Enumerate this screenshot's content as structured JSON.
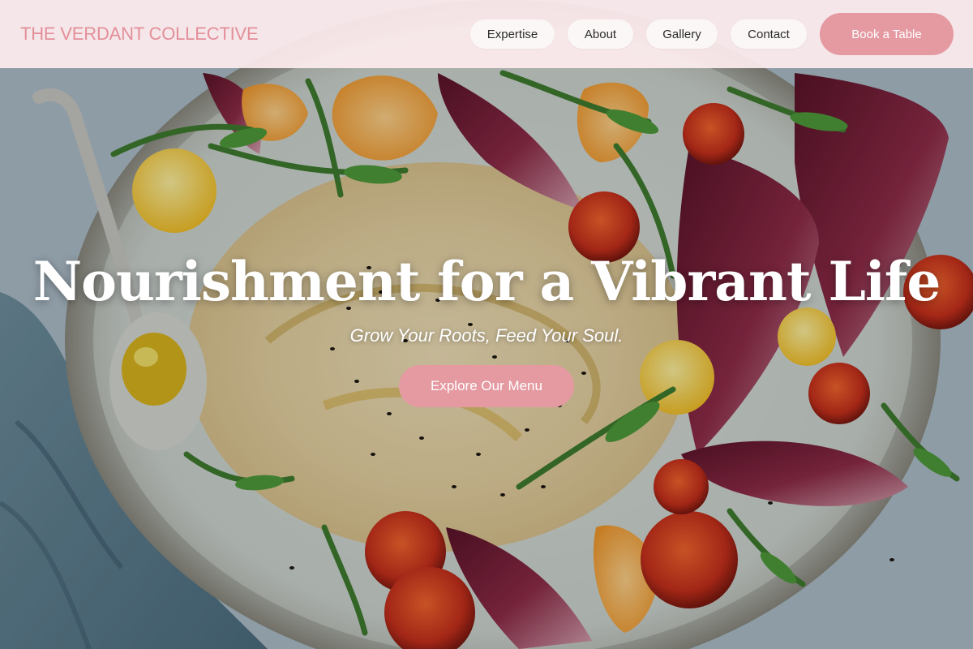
{
  "header": {
    "brand": "THE VERDANT COLLECTIVE",
    "nav": [
      {
        "label": "Expertise"
      },
      {
        "label": "About"
      },
      {
        "label": "Gallery"
      },
      {
        "label": "Contact"
      }
    ],
    "cta_label": "Book a Table"
  },
  "hero": {
    "title": "Nourishment for a Vibrant Life",
    "subtitle": "Grow Your Roots, Feed Your Soul.",
    "cta_label": "Explore Our Menu"
  },
  "colors": {
    "accent": "#e59aa2",
    "brand_text": "#e38f99",
    "header_bg": "#fdecee",
    "nav_pill_bg": "#fbf7f6"
  }
}
